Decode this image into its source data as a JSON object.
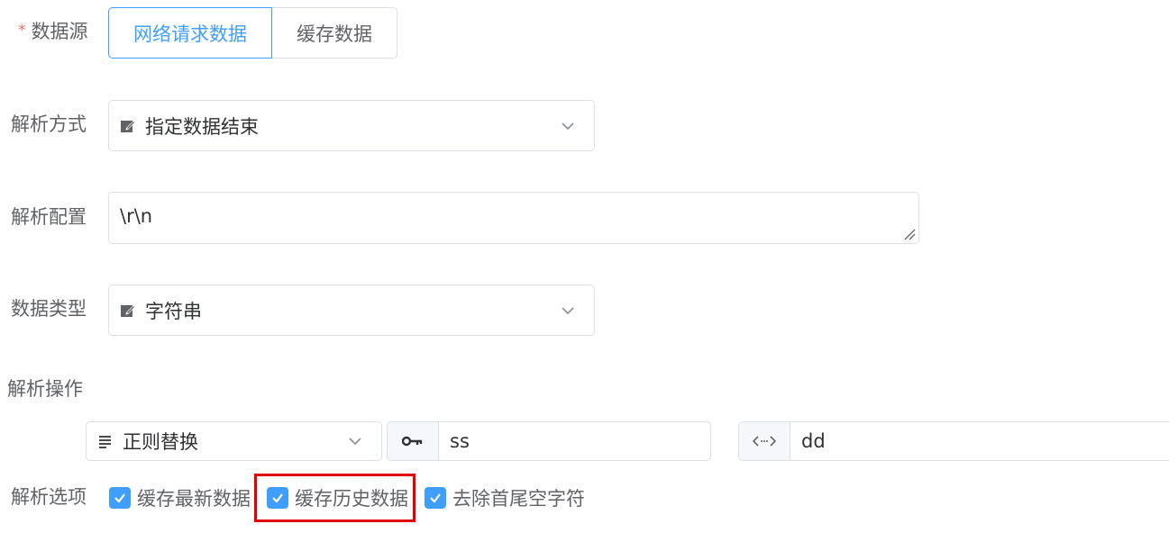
{
  "fields": {
    "data_source": {
      "label": "数据源",
      "required_mark": "*",
      "options": [
        "网络请求数据",
        "缓存数据"
      ],
      "selected": "网络请求数据"
    },
    "parse_method": {
      "label": "解析方式",
      "value": "指定数据结束",
      "icon": "edit-icon"
    },
    "parse_config": {
      "label": "解析配置",
      "value": "\\r\\n"
    },
    "data_type": {
      "label": "数据类型",
      "value": "字符串",
      "icon": "edit-icon"
    },
    "parse_operation": {
      "label": "解析操作",
      "op_select": "正则替换",
      "op_icon": "list-icon",
      "key_value": "ss",
      "key_icon": "key-icon",
      "replace_value": "dd",
      "replace_icon": "code-arrows-icon"
    },
    "parse_options": {
      "label": "解析选项",
      "items": [
        {
          "label": "缓存最新数据",
          "checked": true
        },
        {
          "label": "缓存历史数据",
          "checked": true,
          "highlighted": true
        },
        {
          "label": "去除首尾空字符",
          "checked": true
        }
      ]
    }
  },
  "colors": {
    "primary": "#409eff",
    "highlight": "#e3000b",
    "required": "#f56c6c"
  }
}
